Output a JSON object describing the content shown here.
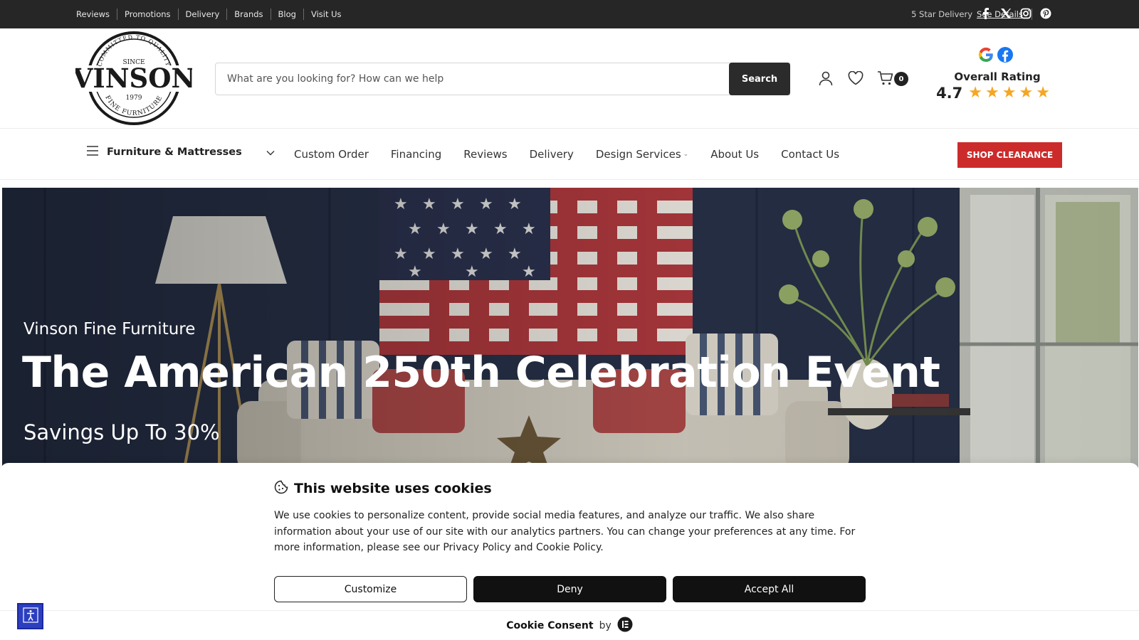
{
  "topbar": {
    "links": [
      "Reviews",
      "Promotions",
      "Delivery",
      "Brands",
      "Blog",
      "Visit Us"
    ],
    "delivery_text": "5 Star Delivery",
    "details_link": "See Details",
    "social_icons": [
      "facebook-icon",
      "x-icon",
      "instagram-icon",
      "pinterest-icon"
    ]
  },
  "logo": {
    "arc_top": "COMMITTED TO QUALITY",
    "since": "SINCE",
    "name": "VINSON",
    "year": "1979",
    "arc_bottom": "FINE FURNITURE"
  },
  "search": {
    "placeholder": "What are you looking for? How can we help",
    "button_label": "Search"
  },
  "header_icons": {
    "account": "user-icon",
    "wishlist": "heart-icon",
    "cart": "cart-icon",
    "cart_count": "0"
  },
  "rating": {
    "title": "Overall Rating",
    "score": "4.7",
    "stars": 4.7,
    "star_color": "#f5a623"
  },
  "nav": {
    "category_label": "Furniture & Mattresses",
    "links": [
      {
        "label": "Custom Order"
      },
      {
        "label": "Financing"
      },
      {
        "label": "Reviews"
      },
      {
        "label": "Delivery"
      },
      {
        "label": "Design Services"
      },
      {
        "label": "About Us"
      },
      {
        "label": "Contact Us"
      }
    ],
    "clearance_label": "SHOP CLEARANCE",
    "clearance_color": "#cc2b2b"
  },
  "hero": {
    "kicker": "Vinson Fine Furniture",
    "headline": "The American 250th Celebration Event",
    "sub": "Savings Up To 30%"
  },
  "cookie": {
    "title": "This website uses cookies",
    "body": "We use cookies to personalize content, provide social media features, and analyze our traffic. We also share information about your use of our site with our analytics partners. You can change your preferences at any time. For more information, please see our Privacy Policy and Cookie Policy.",
    "customize_label": "Customize",
    "deny_label": "Deny",
    "accept_label": "Accept All",
    "footer_brand": "Cookie Consent",
    "footer_by": "by"
  },
  "accessibility": {
    "icon": "accessibility-icon"
  }
}
